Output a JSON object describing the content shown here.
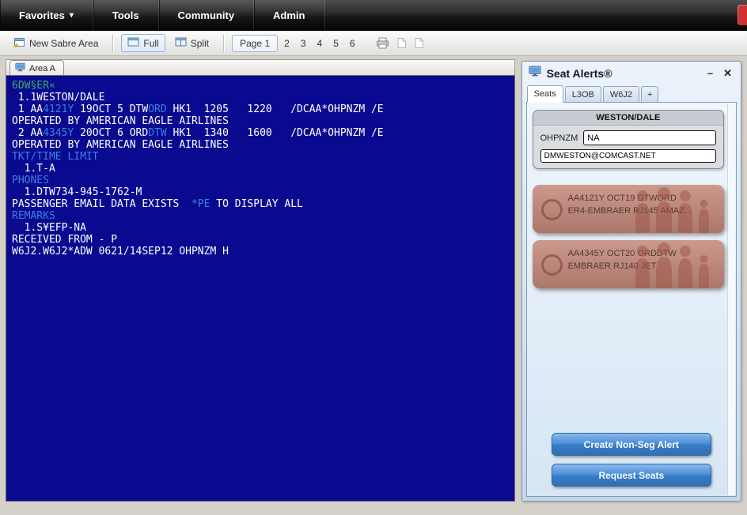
{
  "menu": {
    "items": [
      {
        "label": "Favorites",
        "has_arrow": true
      },
      {
        "label": "Tools"
      },
      {
        "label": "Community"
      },
      {
        "label": "Admin"
      }
    ]
  },
  "toolbar": {
    "new_area_label": "New Sabre Area",
    "view_buttons": {
      "full": "Full",
      "split": "Split"
    },
    "pages": [
      {
        "label": "Page 1",
        "active": true
      },
      {
        "label": "2"
      },
      {
        "label": "3"
      },
      {
        "label": "4"
      },
      {
        "label": "5"
      },
      {
        "label": "6"
      }
    ]
  },
  "terminal": {
    "tab_label": "Area A",
    "colors": {
      "background": "#0a0a90",
      "white": "#ffffff",
      "blue": "#3c7fe0",
      "green": "#3fae5c"
    },
    "lines": [
      [
        {
          "t": "6DW§ER«",
          "c": "g"
        }
      ],
      [
        {
          "t": " 1.1WESTON/DALE",
          "c": "w"
        }
      ],
      [
        {
          "t": " 1 AA",
          "c": "w"
        },
        {
          "t": "4121Y",
          "c": "b"
        },
        {
          "t": " 19OCT 5 DTW",
          "c": "w"
        },
        {
          "t": "ORD",
          "c": "b"
        },
        {
          "t": " HK1  1205   1220   /DCAA*OHPNZM /E",
          "c": "w"
        }
      ],
      [
        {
          "t": "OPERATED BY AMERICAN EAGLE AIRLINES",
          "c": "w"
        }
      ],
      [
        {
          "t": " 2 AA",
          "c": "w"
        },
        {
          "t": "4345Y",
          "c": "b"
        },
        {
          "t": " 20OCT 6 ORD",
          "c": "w"
        },
        {
          "t": "DTW",
          "c": "b"
        },
        {
          "t": " HK1  1340   1600   /DCAA*OHPNZM /E",
          "c": "w"
        }
      ],
      [
        {
          "t": "OPERATED BY AMERICAN EAGLE AIRLINES",
          "c": "w"
        }
      ],
      [
        {
          "t": "TKT/TIME LIMIT",
          "c": "b"
        }
      ],
      [
        {
          "t": "  1.T-A",
          "c": "w"
        }
      ],
      [
        {
          "t": "PHONES",
          "c": "b"
        }
      ],
      [
        {
          "t": "  1.DTW734-945-1762-M",
          "c": "w"
        }
      ],
      [
        {
          "t": "PASSENGER EMAIL DATA EXISTS  ",
          "c": "w"
        },
        {
          "t": "*PE",
          "c": "b"
        },
        {
          "t": " TO DISPLAY ALL",
          "c": "w"
        }
      ],
      [
        {
          "t": "REMARKS",
          "c": "b"
        }
      ],
      [
        {
          "t": "  1.S¥EFP-NA",
          "c": "w"
        }
      ],
      [
        {
          "t": "RECEIVED FROM - P",
          "c": "w"
        }
      ],
      [
        {
          "t": "W6J2.W6J2*ADW 0621/14SEP12 OHPNZM H",
          "c": "w"
        }
      ]
    ]
  },
  "seat_alerts": {
    "title": "Seat Alerts®",
    "window_controls": {
      "minimize": "–",
      "close": "✕"
    },
    "tabs": [
      {
        "label": "Seats",
        "active": true
      },
      {
        "label": "L3OB"
      },
      {
        "label": "W6J2"
      },
      {
        "label": "+",
        "small": true
      }
    ],
    "pnr": {
      "name": "WESTON/DALE",
      "locator": "OHPNZM",
      "field_value": "NA",
      "email": "DMWESTON@COMCAST.NET"
    },
    "alerts": [
      {
        "flight": "AA4121Y OCT19 DTWORD",
        "aircraft": "ER4-EMBRAER RJ145 AMAZ..."
      },
      {
        "flight": "AA4345Y OCT20 ORDDTW",
        "aircraft": "EMBRAER RJ140  JET"
      }
    ],
    "buttons": {
      "create": "Create Non-Seg Alert",
      "request": "Request Seats"
    },
    "accent_color": "#3d87d9",
    "card_color": "#c4887a"
  }
}
